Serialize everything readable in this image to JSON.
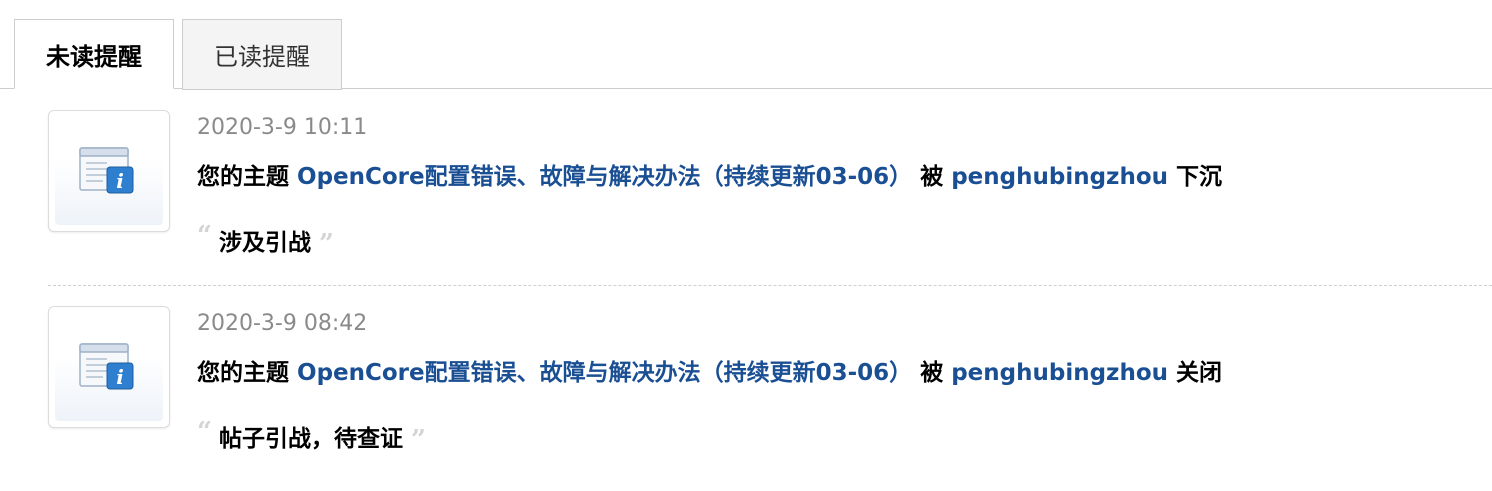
{
  "tabs": [
    {
      "label": "未读提醒",
      "active": true
    },
    {
      "label": "已读提醒",
      "active": false
    }
  ],
  "notices": [
    {
      "timestamp": "2020-3-9 10:11",
      "prefix": "您的主题",
      "topic_link": "OpenCore配置错误、故障与解决办法（持续更新03-06）",
      "by": "被",
      "user_link": "penghubingzhou",
      "action": "下沉",
      "reason": "涉及引战",
      "icon": "info-window-icon"
    },
    {
      "timestamp": "2020-3-9 08:42",
      "prefix": "您的主题",
      "topic_link": "OpenCore配置错误、故障与解决办法（持续更新03-06）",
      "by": "被",
      "user_link": "penghubingzhou",
      "action": "关闭",
      "reason": "帖子引战，待查证",
      "icon": "info-window-icon"
    }
  ],
  "colors": {
    "link": "#1a4f94",
    "timestamp": "#8a8a8a",
    "border": "#cdcdcd",
    "quote": "#d4d4d4"
  }
}
